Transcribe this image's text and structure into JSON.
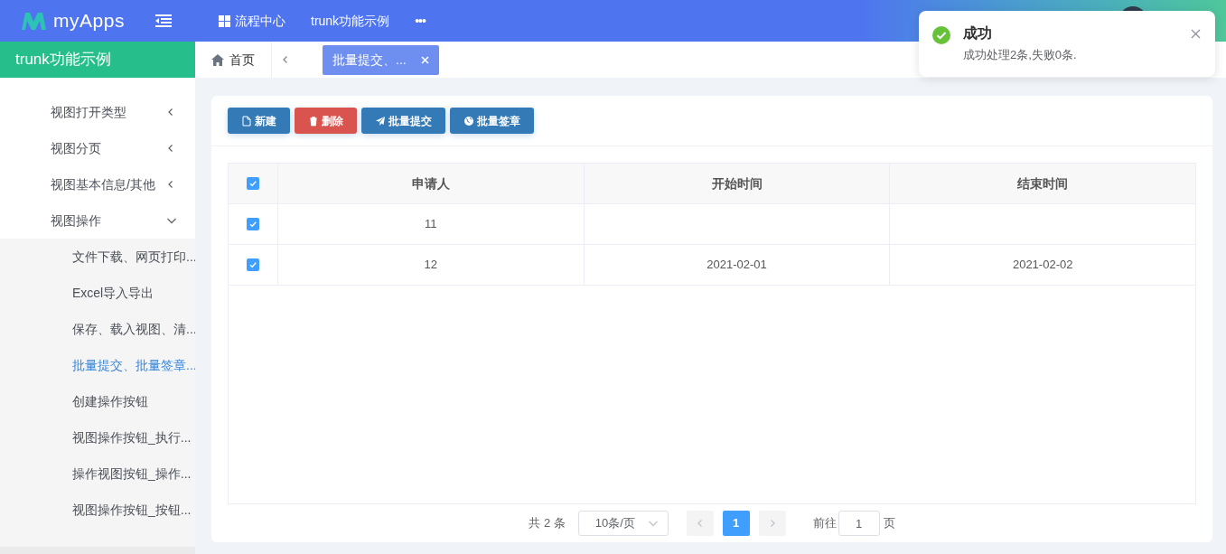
{
  "header": {
    "logo": "myApps",
    "menu": [
      {
        "label": "流程中心",
        "kind": "grid"
      },
      {
        "label": "trunk功能示例",
        "kind": "plain"
      },
      {
        "label": "•••",
        "kind": "more"
      }
    ]
  },
  "sidebar": {
    "title": "trunk功能示例",
    "items": [
      {
        "label": "视图打开类型",
        "expanded": false
      },
      {
        "label": "视图分页",
        "expanded": false
      },
      {
        "label": "视图基本信息/其他",
        "expanded": false
      },
      {
        "label": "视图操作",
        "expanded": true,
        "children": [
          {
            "label": "文件下载、网页打印...",
            "selected": false
          },
          {
            "label": "Excel导入导出",
            "selected": false
          },
          {
            "label": "保存、载入视图、清...",
            "selected": false
          },
          {
            "label": "批量提交、批量签章...",
            "selected": true
          },
          {
            "label": "创建操作按钮",
            "selected": false
          },
          {
            "label": "视图操作按钮_执行...",
            "selected": false
          },
          {
            "label": "操作视图按钮_操作...",
            "selected": false
          },
          {
            "label": "视图操作按钮_按钮...",
            "selected": false
          }
        ]
      }
    ]
  },
  "tabs": [
    {
      "label": "首页",
      "kind": "home",
      "selected": false
    },
    {
      "label": "批量提交、...",
      "kind": "page",
      "selected": true
    }
  ],
  "toolbar": [
    {
      "label": "新建",
      "kind": "new"
    },
    {
      "label": "删除",
      "kind": "delete"
    },
    {
      "label": "批量提交",
      "kind": "submit"
    },
    {
      "label": "批量签章",
      "kind": "sign"
    }
  ],
  "table": {
    "all_checked": true,
    "columns": [
      "申请人",
      "开始时间",
      "结束时间"
    ],
    "rows": [
      {
        "checked": true,
        "cells": [
          "11",
          "",
          ""
        ]
      },
      {
        "checked": true,
        "cells": [
          "12",
          "2021-02-01",
          "2021-02-02"
        ]
      }
    ]
  },
  "pagination": {
    "total": "共 2 条",
    "page_size": "10条/页",
    "pages": [
      {
        "label": "1",
        "selected": true
      }
    ],
    "goto_label": "前往",
    "goto_value": "1",
    "goto_suffix": "页"
  },
  "toast": {
    "title": "成功",
    "message": "成功处理2条,失败0条."
  }
}
